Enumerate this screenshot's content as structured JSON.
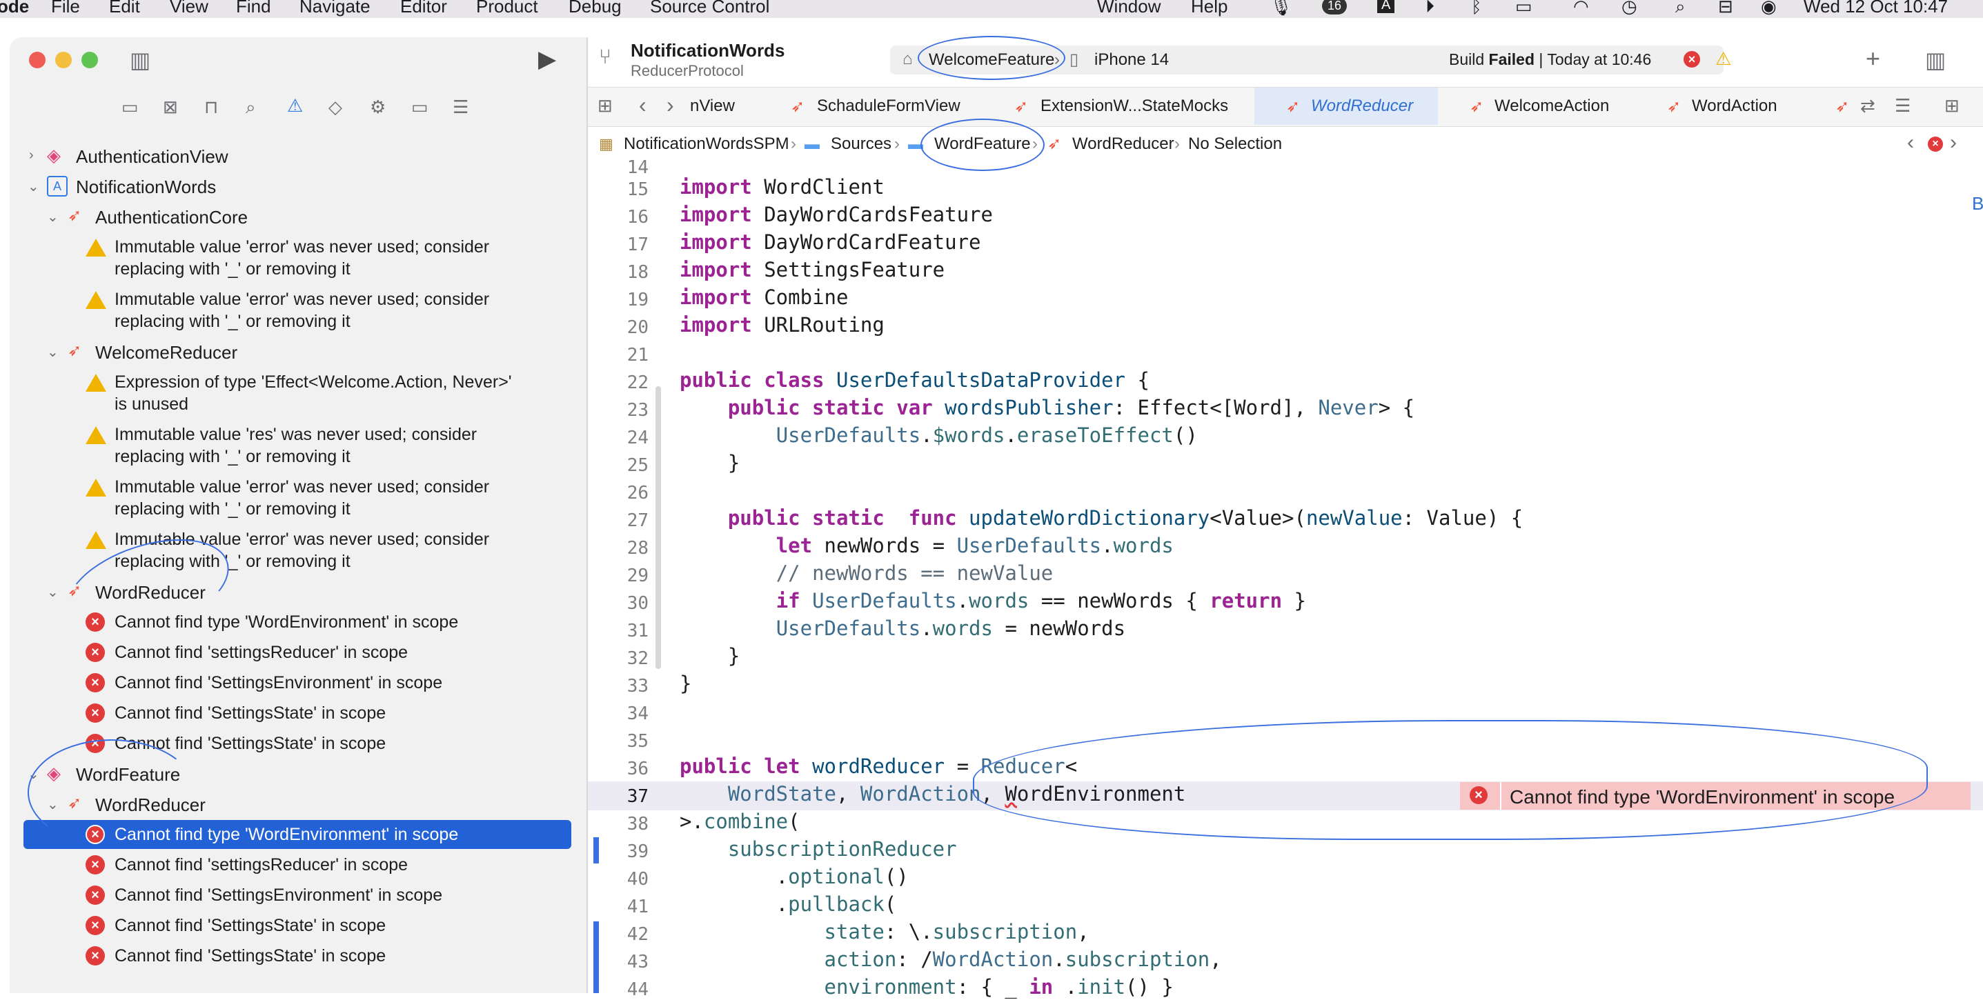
{
  "menubar": {
    "app_fragment": "ode",
    "items": [
      "File",
      "Edit",
      "View",
      "Find",
      "Navigate",
      "Editor",
      "Product",
      "Debug",
      "Source Control",
      "Window",
      "Help"
    ],
    "badge": "16",
    "clock": "Wed 12 Oct  10:47"
  },
  "toolbar": {
    "project_title": "NotificationWords",
    "project_subtitle": "ReducerProtocol",
    "scheme": "WelcomeFeature",
    "device": "iPhone 14",
    "build_status_prefix": "Build ",
    "build_status": "Failed",
    "build_time": "| Today at 10:46"
  },
  "navigator": {
    "items": [
      {
        "label": "AuthenticationView"
      },
      {
        "label": "NotificationWords"
      },
      {
        "label": "AuthenticationCore"
      },
      {
        "line1": "Immutable value 'error' was never used; consider",
        "line2": "replacing with '_' or removing it"
      },
      {
        "line1": "Immutable value 'error' was never used; consider",
        "line2": "replacing with '_' or removing it"
      },
      {
        "label": "WelcomeReducer"
      },
      {
        "line1": "Expression of type 'Effect<Welcome.Action, Never>'",
        "line2": "is unused"
      },
      {
        "line1": "Immutable value 'res' was never used; consider",
        "line2": "replacing with '_' or removing it"
      },
      {
        "line1": "Immutable value 'error' was never used; consider",
        "line2": "replacing with '_' or removing it"
      },
      {
        "line1": "Immutable value 'error' was never used; consider",
        "line2": "replacing with '_' or removing it"
      },
      {
        "label": "WordReducer"
      },
      {
        "label": "Cannot find type 'WordEnvironment' in scope"
      },
      {
        "label": "Cannot find 'settingsReducer' in scope"
      },
      {
        "label": "Cannot find 'SettingsEnvironment' in scope"
      },
      {
        "label": "Cannot find 'SettingsState' in scope"
      },
      {
        "label": "Cannot find 'SettingsState' in scope"
      },
      {
        "label": "WordFeature"
      },
      {
        "label": "WordReducer"
      },
      {
        "label": "Cannot find type 'WordEnvironment' in scope"
      },
      {
        "label": "Cannot find 'settingsReducer' in scope"
      },
      {
        "label": "Cannot find 'SettingsEnvironment' in scope"
      },
      {
        "label": "Cannot find 'SettingsState' in scope"
      },
      {
        "label": "Cannot find 'SettingsState' in scope"
      }
    ]
  },
  "tabs": [
    "nView",
    "SchaduleFormView",
    "ExtensionW...StateMocks",
    "WordReducer",
    "WelcomeAction",
    "WordAction"
  ],
  "breadcrumb": [
    "NotificationWordsSPM",
    "Sources",
    "WordFeature",
    "WordReducer",
    "No Selection"
  ],
  "editor": {
    "line_numbers": [
      "14",
      "15",
      "16",
      "17",
      "18",
      "19",
      "20",
      "21",
      "22",
      "23",
      "24",
      "25",
      "26",
      "27",
      "28",
      "29",
      "30",
      "31",
      "32",
      "33",
      "34",
      "35",
      "36",
      "37",
      "38",
      "39",
      "40",
      "41",
      "42",
      "43",
      "44"
    ],
    "inline_error": "Cannot find type 'WordEnvironment' in scope"
  },
  "colors": {
    "accent": "#2361d6",
    "error": "#e13a3a",
    "warning": "#f0b400",
    "swift": "#f05138"
  }
}
